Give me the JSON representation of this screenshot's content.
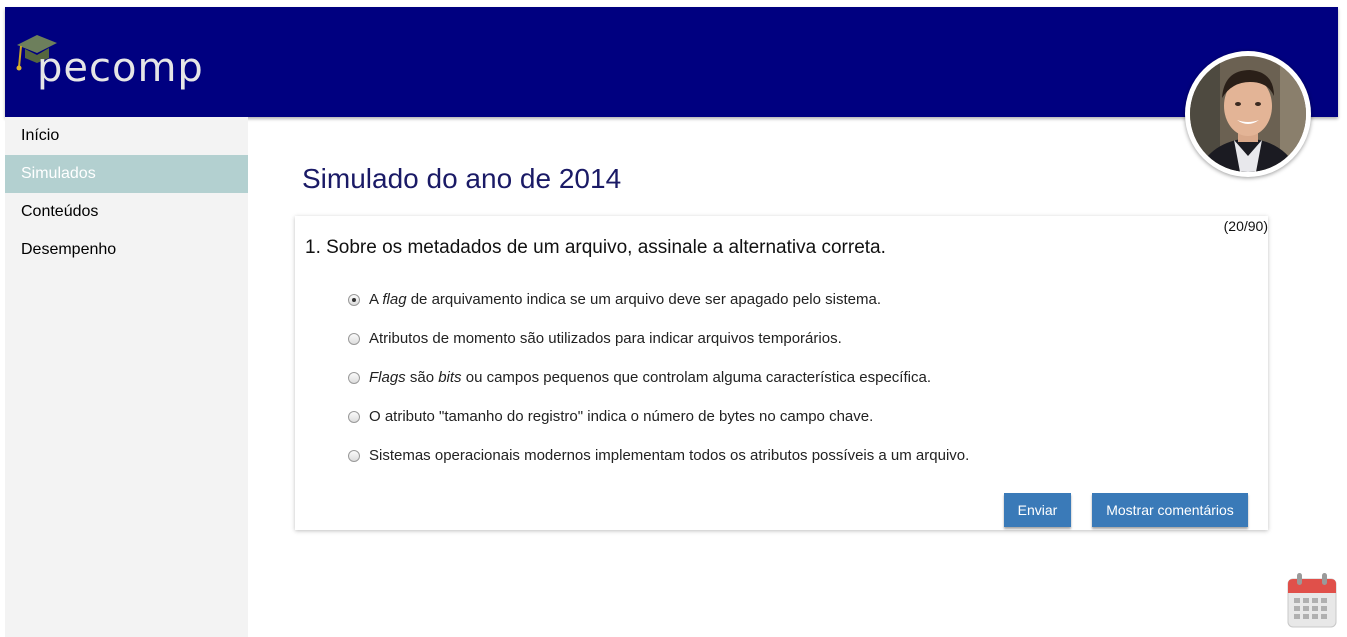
{
  "header": {
    "logo_text": "pecomp"
  },
  "sidebar": {
    "items": [
      {
        "label": "Início",
        "active": false
      },
      {
        "label": "Simulados",
        "active": true
      },
      {
        "label": "Conteúdos",
        "active": false
      },
      {
        "label": "Desempenho",
        "active": false
      }
    ]
  },
  "main": {
    "title": "Simulado do ano de 2014",
    "counter": "(20/90)",
    "question": "1. Sobre os metadados de um arquivo, assinale a alternativa correta.",
    "options": [
      {
        "parts": [
          {
            "t": "A ",
            "i": false
          },
          {
            "t": "flag",
            "i": true
          },
          {
            "t": " de arquivamento indica se um arquivo deve ser apagado pelo sistema.",
            "i": false
          }
        ],
        "selected": true
      },
      {
        "parts": [
          {
            "t": "Atributos de momento são utilizados para indicar arquivos temporários.",
            "i": false
          }
        ],
        "selected": false
      },
      {
        "parts": [
          {
            "t": "Flags",
            "i": true
          },
          {
            "t": " são ",
            "i": false
          },
          {
            "t": "bits",
            "i": true
          },
          {
            "t": " ou campos pequenos que controlam alguma característica específica.",
            "i": false
          }
        ],
        "selected": false
      },
      {
        "parts": [
          {
            "t": "O atributo \"tamanho do registro\" indica o número de bytes no campo chave.",
            "i": false
          }
        ],
        "selected": false
      },
      {
        "parts": [
          {
            "t": "Sistemas operacionais modernos implementam todos os atributos possíveis a um arquivo.",
            "i": false
          }
        ],
        "selected": false
      }
    ],
    "buttons": {
      "send": "Enviar",
      "comments": "Mostrar comentários"
    }
  },
  "colors": {
    "header_bg": "#000080",
    "sidebar_active": "#b3d0d0",
    "button": "#3a7ab8",
    "title": "#1a1a66"
  },
  "icons": [
    "graduation-cap-icon",
    "avatar",
    "calendar-icon"
  ]
}
